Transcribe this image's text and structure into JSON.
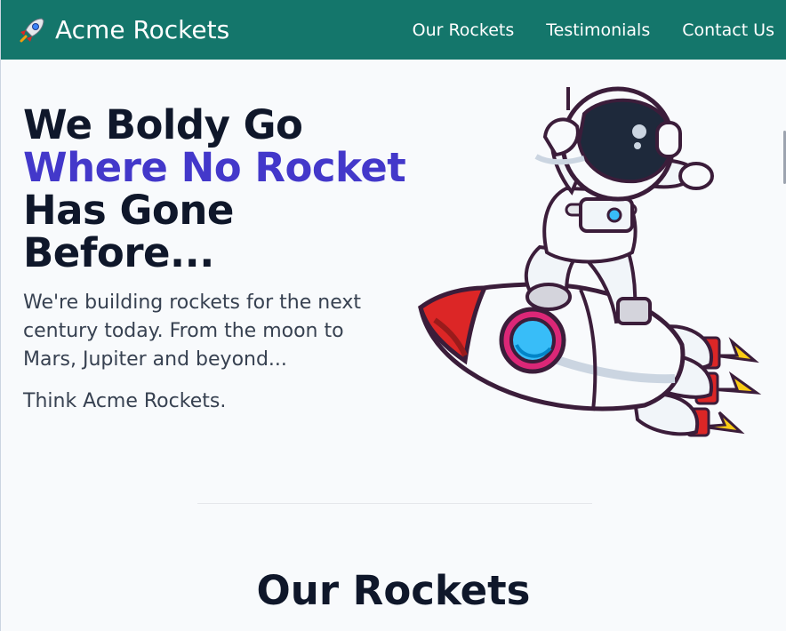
{
  "brand": {
    "name": "Acme Rockets",
    "icon": "rocket-icon"
  },
  "nav": {
    "links": [
      {
        "label": "Our Rockets"
      },
      {
        "label": "Testimonials"
      },
      {
        "label": "Contact Us"
      }
    ]
  },
  "hero": {
    "title_line1": "We Boldy Go",
    "title_accent": "Where No Rocket",
    "title_line3": "Has Gone",
    "title_line4": "Before...",
    "description": "We're building rockets for the next century today. From the moon to Mars, Jupiter and beyond...",
    "tagline": "Think Acme Rockets.",
    "illustration": "astronaut-riding-rocket-illustration"
  },
  "sections": {
    "rockets_title": "Our Rockets"
  },
  "colors": {
    "navbar": "#14766b",
    "accent": "#4338ca",
    "text_dark": "#0f172a",
    "page_background": "#f8fafc"
  }
}
